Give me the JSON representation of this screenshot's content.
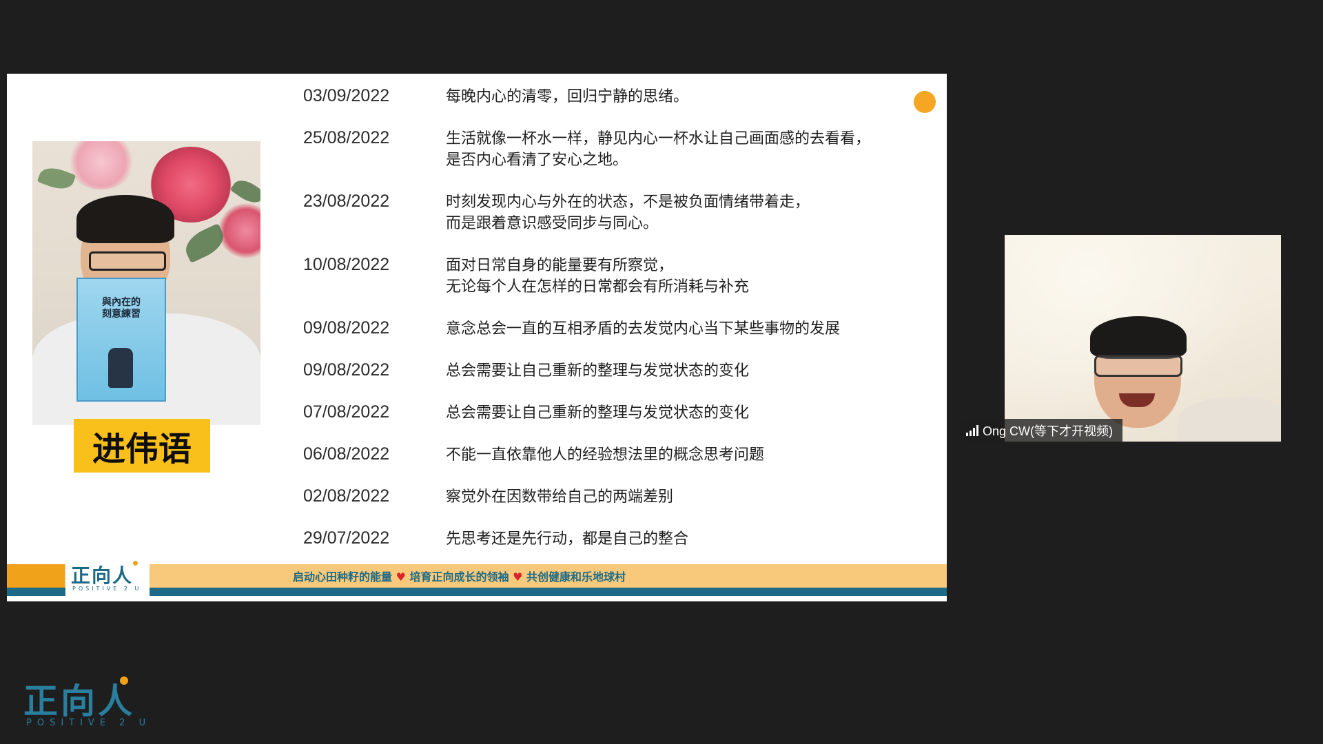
{
  "slide": {
    "name_plate": "进伟语",
    "book": {
      "title": "與內在的\n刻意練習"
    },
    "entries": [
      {
        "date": "03/09/2022",
        "text": "每晚内心的清零，回归宁静的思绪。"
      },
      {
        "date": "25/08/2022",
        "text": "生活就像一杯水一样，静见内心一杯水让自己画面感的去看看，\n是否内心看清了安心之地。"
      },
      {
        "date": "23/08/2022",
        "text": "时刻发现内心与外在的状态，不是被负面情绪带着走，\n而是跟着意识感受同步与同心。"
      },
      {
        "date": "10/08/2022",
        "text": "面对日常自身的能量要有所察觉，\n无论每个人在怎样的日常都会有所消耗与补充"
      },
      {
        "date": "09/08/2022",
        "text": "意念总会一直的互相矛盾的去发觉内心当下某些事物的发展"
      },
      {
        "date": "09/08/2022",
        "text": "总会需要让自己重新的整理与发觉状态的变化"
      },
      {
        "date": "07/08/2022",
        "text": "总会需要让自己重新的整理与发觉状态的变化"
      },
      {
        "date": "06/08/2022",
        "text": "不能一直依靠他人的经验想法里的概念思考问题"
      },
      {
        "date": "02/08/2022",
        "text": "察觉外在因数带给自己的两端差别"
      },
      {
        "date": "29/07/2022",
        "text": "先思考还是先行动，都是自己的整合"
      }
    ],
    "footer": {
      "logo_cn": "正向人",
      "logo_en": "POSITIVE 2 U",
      "slogan_1": "启动心田种籽的能量",
      "slogan_2": "培育正向成长的领袖",
      "slogan_3": "共创健康和乐地球村",
      "heart": "♥"
    },
    "colors": {
      "accent": "#f5a623",
      "teal": "#1c6a86",
      "name_plate": "#f9c01b"
    }
  },
  "participant": {
    "name": "Ong CW(等下才开视频)",
    "icon": "signal-strength-icon"
  },
  "watermark": {
    "cn": "正向人",
    "en": "POSITIVE 2 U"
  }
}
